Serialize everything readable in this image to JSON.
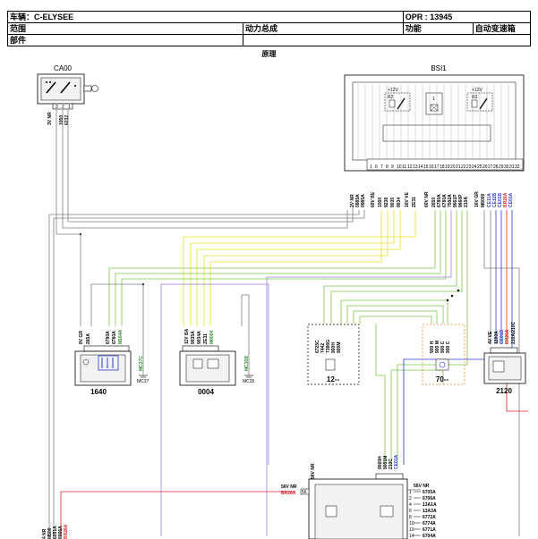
{
  "header": {
    "vehicle_label": "车辆：C-ELYSEE",
    "opr_label": "OPR : 13945",
    "scope_label": "范围",
    "assembly_value": "动力总成",
    "function_label": "功能",
    "function_value": "自动变速箱",
    "parts_label": "部件"
  },
  "diagram_title": "原理",
  "components": {
    "ca00": {
      "id": "CA00",
      "wire_note": "3V NR",
      "wires": [
        "1050",
        "6232"
      ],
      "pins": [
        "3",
        "2",
        "1"
      ]
    },
    "bsi1": {
      "id": "BSI1",
      "supply_left": "+12V",
      "supply_right": "+12V",
      "relay_left": "R2",
      "relay_right": "R3",
      "relay_num": "1",
      "groups": [
        {
          "label": "2V NR",
          "wires": [
            "0985A",
            "0985A"
          ]
        },
        {
          "label": "60V BE",
          "wires": [
            "1000",
            "9238",
            "9035",
            "9034"
          ]
        },
        {
          "label": "16V VE",
          "wires": [
            "ZE31"
          ]
        },
        {
          "label": "60V NR",
          "wires": [
            "2650",
            "6780A",
            "6780A",
            "7592A",
            "9661P",
            "9660P",
            "210A"
          ]
        },
        {
          "label": "16V GR",
          "wires": [
            "M8000"
          ]
        }
      ],
      "can_wires": [
        "CE11A",
        "CE12B",
        "CE01B",
        "BR26A",
        "CE01A"
      ],
      "pin_numbers": [
        "1",
        "6",
        "7",
        "8",
        "9",
        "10",
        "11",
        "12",
        "13",
        "14",
        "15",
        "16",
        "17",
        "18",
        "19",
        "20",
        "21",
        "22",
        "23",
        "24",
        "25",
        "26",
        "27",
        "28",
        "29",
        "30",
        "31",
        "32"
      ]
    },
    "c1640": {
      "id": "1640",
      "wire_note": "8V GR",
      "wires": [
        "265A",
        "6780A",
        "6780A",
        "M164A"
      ],
      "pins": [
        "3",
        "2",
        "5",
        "6",
        "8",
        "1"
      ]
    },
    "c0004": {
      "id": "0004",
      "wire_note": "11V BA",
      "wires": [
        "9035A",
        "9034A",
        "ZE31",
        "M0004"
      ],
      "pins": [
        "6",
        "5",
        "4",
        "3",
        "7",
        "1"
      ]
    },
    "c12": {
      "id": "12--",
      "wires": [
        "6725C",
        "7442",
        "7396G",
        "900H",
        "900M"
      ]
    },
    "c70": {
      "id": "70--",
      "wires": [
        "900 H",
        "900 M",
        "900 C",
        "900 C"
      ]
    },
    "c2120": {
      "id": "2120",
      "wire_note": "4V VE",
      "wires": [
        "1200A",
        "CE01B",
        "BR26A",
        "210A/210C"
      ],
      "pins": [
        "4",
        "3",
        "2",
        "1"
      ]
    },
    "ground_mc37": {
      "wire": "MC37C",
      "label": "MC37"
    },
    "ground_mc35": {
      "wire": "MC35B",
      "label": "MC35"
    },
    "ecu": {
      "top_note": "56V NR",
      "top_wires": [
        "9000H",
        "9001M",
        "210C",
        "CE01A"
      ],
      "left_note": "56V NR",
      "left_wire": "BR26A",
      "left_pin": "56",
      "right_note": "56V NR",
      "right_wires": [
        "6705A",
        "6706A",
        "13A1A",
        "13A3A",
        "6772A",
        "6774A",
        "6771A",
        "6704A"
      ],
      "right_pins": [
        "1",
        "2",
        "4",
        "6",
        "8",
        "10",
        "12",
        "14"
      ]
    },
    "bottom_left": {
      "note": "4 NR",
      "wires": [
        "M500",
        "6051A",
        "8006A",
        "BR26A"
      ]
    }
  },
  "colors": {
    "wire_yellow": "#e8e020",
    "wire_green": "#7ac943",
    "wire_blue": "#2a3bd6",
    "wire_red": "#e02020",
    "wire_purple": "#9a7fd8",
    "wire_gray": "#808080",
    "wire_pink": "#e07a9a"
  }
}
